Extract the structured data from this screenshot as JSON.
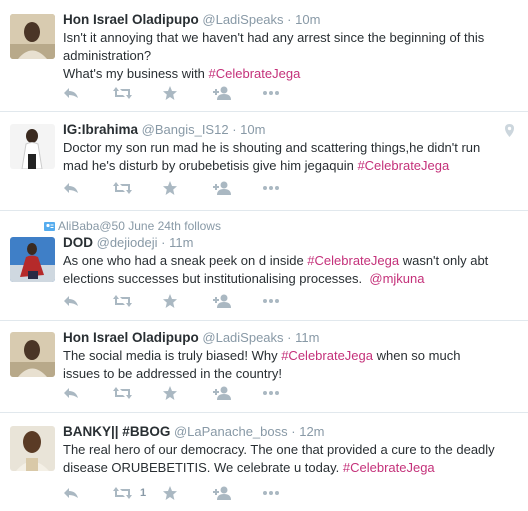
{
  "colors": {
    "hashtag": "#c4317a",
    "meta": "#8899a6",
    "text": "#292f33",
    "divider": "#e1e8ed"
  },
  "tweets": [
    {
      "fullname": "Hon Israel Oladipupo",
      "username": "@LadiSpeaks",
      "sep": "·",
      "time": "10m",
      "lines": [
        "Isn't it annoying that we haven't had any arrest since the beginning of this",
        "administration?",
        "What's my business with "
      ],
      "hashtag": "#CelebrateJega"
    },
    {
      "fullname": "IG:Ibrahima",
      "username": "@Bangis_IS12",
      "sep": "·",
      "time": "10m",
      "lines": [
        "Doctor my son run mad he is shouting and scattering things,he didn't run",
        "mad he's disturb by orubebetisis give him jegaquin "
      ],
      "hashtag": "#CelebrateJega",
      "icon": "location-pin-icon"
    },
    {
      "context": "AliBaba@50 June 24th follows",
      "fullname": "DOD",
      "username": "@dejiodeji",
      "sep": "·",
      "time": "11m",
      "line1_pre": "As one who had a sneak peek on d inside ",
      "hashtag": "#CelebrateJega",
      "line1_post": " wasn't only abt",
      "line2_pre": "elections successes but institutionalising processes.  ",
      "mention": "@mjkuna"
    },
    {
      "fullname": "Hon Israel Oladipupo",
      "username": "@LadiSpeaks",
      "sep": "·",
      "time": "11m",
      "line1_pre": "The social media is truly biased! Why ",
      "hashtag": "#CelebrateJega",
      "line1_post": " when so much",
      "line2": "issues to be addressed in the country!"
    },
    {
      "fullname": "BANKY|| #BBOG",
      "username": "@LaPanache_boss",
      "sep": "·",
      "time": "12m",
      "lines": [
        "The real hero of our democracy. The one that provided a cure to the deadly",
        "disease ORUBEBETITIS. We celebrate u today. "
      ],
      "hashtag": "#CelebrateJega",
      "retweet_count": "1"
    }
  ]
}
